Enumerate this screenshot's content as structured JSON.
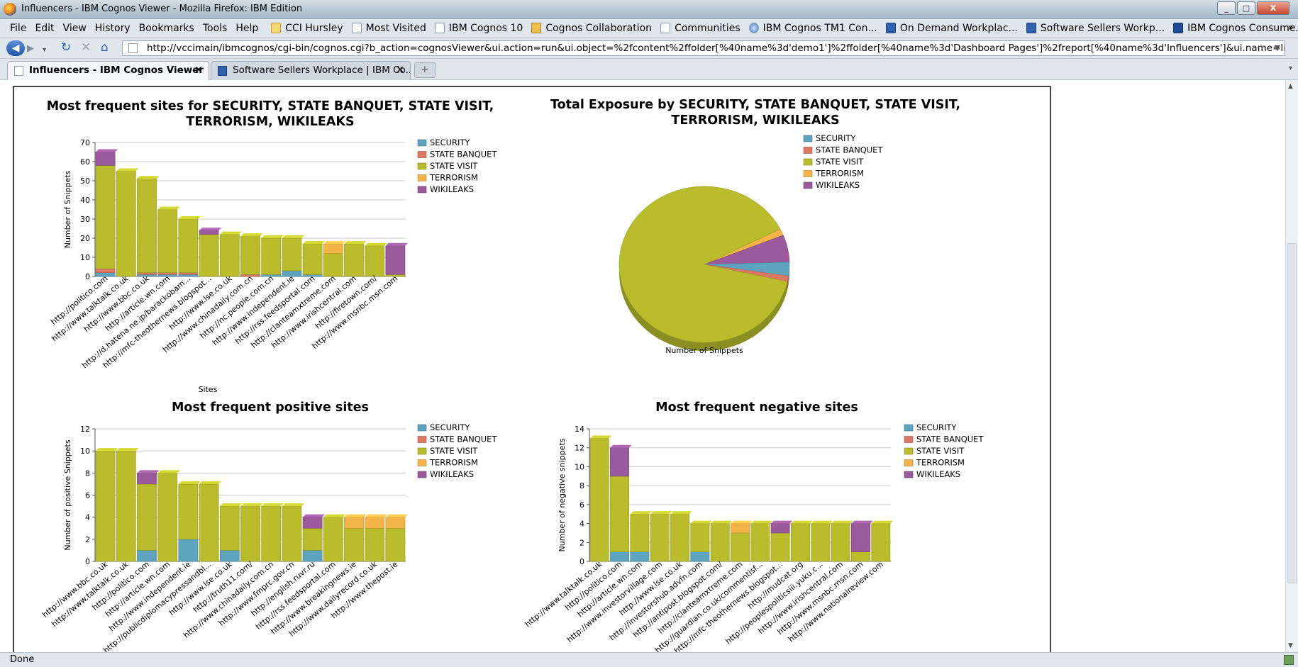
{
  "window": {
    "title": "Influencers - IBM Cognos Viewer - Mozilla Firefox: IBM Edition",
    "min": "_",
    "max": "□",
    "close": "X"
  },
  "menu": [
    "File",
    "Edit",
    "View",
    "History",
    "Bookmarks",
    "Tools",
    "Help"
  ],
  "bookmarks": [
    {
      "label": "CCI Hursley",
      "icon": "folder-icon"
    },
    {
      "label": "Most Visited",
      "icon": "search-icon"
    },
    {
      "label": "IBM Cognos 10",
      "icon": "page-icon"
    },
    {
      "label": "Cognos Collaboration",
      "icon": "house-icon"
    },
    {
      "label": "Communities",
      "icon": "people-icon"
    },
    {
      "label": "IBM Cognos TM1 Con...",
      "icon": "globe-icon"
    },
    {
      "label": "On Demand Workplac...",
      "icon": "wc-icon"
    },
    {
      "label": "Software Sellers Workp...",
      "icon": "wc-icon"
    },
    {
      "label": "IBM Cognos Consume...",
      "icon": "ibm-icon"
    }
  ],
  "bookmarks_more": "»",
  "url": "http://vccimain/ibmcognos/cgi-bin/cognos.cgi?b_action=cognosViewer&ui.action=run&ui.object=%2fcontent%2ffolder[%40name%3d'demo1']%2ffolder[%40name%3d'Dashboard Pages']%2freport[%40name%3d'Influencers']&ui.name=Influencers&run.outp",
  "tabs": [
    {
      "label": "Influencers - IBM Cognos Viewer",
      "active": true
    },
    {
      "label": "Software Sellers Workplace | IBM Co...",
      "active": false
    }
  ],
  "status": "Done",
  "colors": {
    "SECURITY": "#5fa4bf",
    "STATE BANQUET": "#dc7864",
    "STATE VISIT": "#b9bd2c",
    "TERRORISM": "#f2b446",
    "WIKILEAKS": "#9a5a9c"
  },
  "chart_data": [
    {
      "id": "sites",
      "type": "bar",
      "stacked": true,
      "title": "Most frequent sites for SECURITY, STATE BANQUET, STATE VISIT, TERRORISM, WIKILEAKS",
      "title_lines": [
        "Most frequent sites for SECURITY, STATE BANQUET, STATE VISIT,",
        "TERRORISM, WIKILEAKS"
      ],
      "xlabel": "Sites",
      "ylabel": "Number of Snippets",
      "ylim": [
        0,
        70
      ],
      "yticks": [
        0,
        10,
        20,
        30,
        40,
        50,
        60,
        70
      ],
      "legend": "right",
      "categories": [
        "http://politico.com",
        "http://www.talktalk.co.uk",
        "http://www.bbc.co.uk",
        "http://article.wn.com",
        "http://d.hatena.ne.jp/barackobam...",
        "http://mfc-theothernews.blogspot...",
        "http://www.lse.co.uk",
        "http://www.chinadaily.com.cn",
        "http://nc.people.com.cn",
        "http://www.independent.ie",
        "http://rss.feedsportal.com",
        "http://clanteamxtreme.com",
        "http://www.irishcentral.com",
        "http://firetown.com/",
        "http://www.msnbc.msn.com"
      ],
      "series": [
        {
          "name": "SECURITY",
          "values": [
            2,
            0,
            1,
            1,
            1,
            0,
            0,
            0,
            1,
            3,
            1,
            0,
            0,
            0,
            0
          ]
        },
        {
          "name": "STATE BANQUET",
          "values": [
            2,
            0,
            1,
            1,
            1,
            0,
            0,
            1,
            0,
            0,
            0,
            0,
            0,
            0,
            0
          ]
        },
        {
          "name": "STATE VISIT",
          "values": [
            54,
            55,
            49,
            33,
            28,
            22,
            22,
            20,
            19,
            17,
            16,
            12,
            17,
            16,
            1
          ]
        },
        {
          "name": "TERRORISM",
          "values": [
            0,
            0,
            0,
            0,
            0,
            0,
            0,
            0,
            0,
            0,
            0,
            5,
            0,
            0,
            0
          ]
        },
        {
          "name": "WIKILEAKS",
          "values": [
            7,
            0,
            0,
            0,
            0,
            2,
            0,
            0,
            0,
            0,
            0,
            0,
            0,
            0,
            15
          ]
        }
      ]
    },
    {
      "id": "exposure",
      "type": "pie",
      "title": "Total Exposure by SECURITY, STATE BANQUET, STATE VISIT, TERRORISM, WIKILEAKS",
      "title_lines": [
        "Total Exposure by SECURITY, STATE BANQUET, STATE VISIT,",
        "TERRORISM, WIKILEAKS"
      ],
      "xlabel": "Number of Snippets",
      "legend": "top-right",
      "categories": [
        "SECURITY",
        "STATE BANQUET",
        "STATE VISIT",
        "TERRORISM",
        "WIKILEAKS"
      ],
      "values": [
        12,
        5,
        378,
        6,
        24
      ]
    },
    {
      "id": "positive",
      "type": "bar",
      "stacked": true,
      "title": "Most frequent positive sites",
      "title_lines": [
        "Most frequent positive sites"
      ],
      "xlabel": "",
      "ylabel": "Number of positive Snippets",
      "ylim": [
        0,
        12
      ],
      "yticks": [
        0,
        2,
        4,
        6,
        8,
        10,
        12
      ],
      "legend": "right",
      "categories": [
        "http://www.bbc.co.uk",
        "http://www.talktalk.co.uk",
        "http://politico.com",
        "http://article.wn.com",
        "http://www.independent.ie",
        "http://publicdiplomacypressandbl...",
        "http://www.lse.co.uk",
        "http://truth11.com/",
        "http://www.chinadaily.com.cn",
        "http://www.fmprc.gov.cn",
        "http://english.ruvr.ru",
        "http://rss.feedsportal.com",
        "http://www.breakingnews.ie",
        "http://www.dailyrecord.co.uk",
        "http://www.thepost.ie"
      ],
      "series": [
        {
          "name": "SECURITY",
          "values": [
            0,
            0,
            1,
            0,
            2,
            0,
            1,
            0,
            0,
            0,
            1,
            0,
            0,
            0,
            0
          ]
        },
        {
          "name": "STATE BANQUET",
          "values": [
            0,
            0,
            0,
            0,
            0,
            0,
            0,
            0,
            0,
            0,
            0,
            0,
            0,
            0,
            0
          ]
        },
        {
          "name": "STATE VISIT",
          "values": [
            10,
            10,
            6,
            8,
            5,
            7,
            4,
            5,
            5,
            5,
            2,
            4,
            3,
            3,
            3
          ]
        },
        {
          "name": "TERRORISM",
          "values": [
            0,
            0,
            0,
            0,
            0,
            0,
            0,
            0,
            0,
            0,
            0,
            0,
            1,
            1,
            1
          ]
        },
        {
          "name": "WIKILEAKS",
          "values": [
            0,
            0,
            1,
            0,
            0,
            0,
            0,
            0,
            0,
            0,
            1,
            0,
            0,
            0,
            0
          ]
        }
      ]
    },
    {
      "id": "negative",
      "type": "bar",
      "stacked": true,
      "title": "Most frequent negative sites",
      "title_lines": [
        "Most frequent negative sites"
      ],
      "xlabel": "",
      "ylabel": "Number of negative snippets",
      "ylim": [
        0,
        14
      ],
      "yticks": [
        0,
        2,
        4,
        6,
        8,
        10,
        12,
        14
      ],
      "legend": "right",
      "categories": [
        "http://www.talktalk.co.uk",
        "http://politico.com",
        "http://article.wn.com",
        "http://www.investorvillage.com",
        "http://www.lse.co.uk",
        "http://investorshub.advfn.com",
        "http://antipost.blogspot.com/",
        "http://clanteamxtreme.com",
        "http://guardian.co.uk/commentisf...",
        "http://mfc-theothernews.blogspot...",
        "http://mudcat.org",
        "http://peoplespoliticsiii.yuku.c...",
        "http://www.irishcentral.com",
        "http://www.msnbc.msn.com",
        "http://www.nationalreview.com"
      ],
      "series": [
        {
          "name": "SECURITY",
          "values": [
            0,
            1,
            1,
            0,
            0,
            1,
            0,
            0,
            0,
            0,
            0,
            0,
            0,
            0,
            0
          ]
        },
        {
          "name": "STATE BANQUET",
          "values": [
            0,
            0,
            0,
            0,
            0,
            0,
            0,
            0,
            0,
            0,
            0,
            0,
            0,
            0,
            0
          ]
        },
        {
          "name": "STATE VISIT",
          "values": [
            13,
            8,
            4,
            5,
            5,
            3,
            4,
            3,
            4,
            3,
            4,
            4,
            4,
            1,
            4
          ]
        },
        {
          "name": "TERRORISM",
          "values": [
            0,
            0,
            0,
            0,
            0,
            0,
            0,
            1,
            0,
            0,
            0,
            0,
            0,
            0,
            0
          ]
        },
        {
          "name": "WIKILEAKS",
          "values": [
            0,
            3,
            0,
            0,
            0,
            0,
            0,
            0,
            0,
            1,
            0,
            0,
            0,
            3,
            0
          ]
        }
      ]
    }
  ]
}
